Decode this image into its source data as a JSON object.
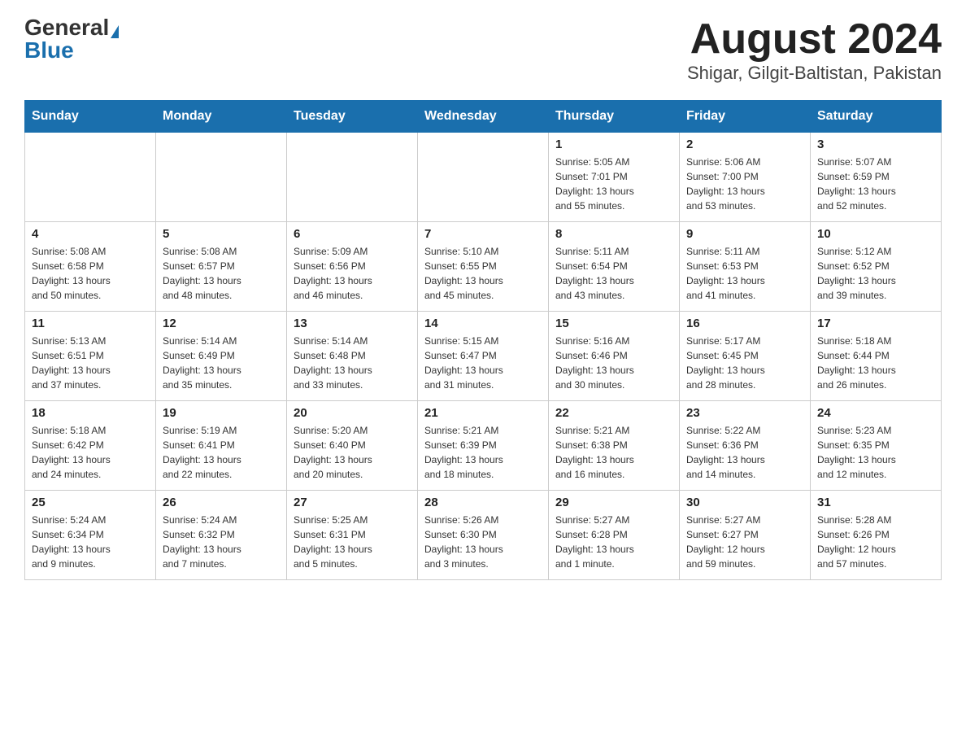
{
  "header": {
    "logo_general": "General",
    "logo_blue": "Blue",
    "month_title": "August 2024",
    "location": "Shigar, Gilgit-Baltistan, Pakistan"
  },
  "weekdays": [
    "Sunday",
    "Monday",
    "Tuesday",
    "Wednesday",
    "Thursday",
    "Friday",
    "Saturday"
  ],
  "weeks": [
    [
      {
        "day": "",
        "info": ""
      },
      {
        "day": "",
        "info": ""
      },
      {
        "day": "",
        "info": ""
      },
      {
        "day": "",
        "info": ""
      },
      {
        "day": "1",
        "info": "Sunrise: 5:05 AM\nSunset: 7:01 PM\nDaylight: 13 hours\nand 55 minutes."
      },
      {
        "day": "2",
        "info": "Sunrise: 5:06 AM\nSunset: 7:00 PM\nDaylight: 13 hours\nand 53 minutes."
      },
      {
        "day": "3",
        "info": "Sunrise: 5:07 AM\nSunset: 6:59 PM\nDaylight: 13 hours\nand 52 minutes."
      }
    ],
    [
      {
        "day": "4",
        "info": "Sunrise: 5:08 AM\nSunset: 6:58 PM\nDaylight: 13 hours\nand 50 minutes."
      },
      {
        "day": "5",
        "info": "Sunrise: 5:08 AM\nSunset: 6:57 PM\nDaylight: 13 hours\nand 48 minutes."
      },
      {
        "day": "6",
        "info": "Sunrise: 5:09 AM\nSunset: 6:56 PM\nDaylight: 13 hours\nand 46 minutes."
      },
      {
        "day": "7",
        "info": "Sunrise: 5:10 AM\nSunset: 6:55 PM\nDaylight: 13 hours\nand 45 minutes."
      },
      {
        "day": "8",
        "info": "Sunrise: 5:11 AM\nSunset: 6:54 PM\nDaylight: 13 hours\nand 43 minutes."
      },
      {
        "day": "9",
        "info": "Sunrise: 5:11 AM\nSunset: 6:53 PM\nDaylight: 13 hours\nand 41 minutes."
      },
      {
        "day": "10",
        "info": "Sunrise: 5:12 AM\nSunset: 6:52 PM\nDaylight: 13 hours\nand 39 minutes."
      }
    ],
    [
      {
        "day": "11",
        "info": "Sunrise: 5:13 AM\nSunset: 6:51 PM\nDaylight: 13 hours\nand 37 minutes."
      },
      {
        "day": "12",
        "info": "Sunrise: 5:14 AM\nSunset: 6:49 PM\nDaylight: 13 hours\nand 35 minutes."
      },
      {
        "day": "13",
        "info": "Sunrise: 5:14 AM\nSunset: 6:48 PM\nDaylight: 13 hours\nand 33 minutes."
      },
      {
        "day": "14",
        "info": "Sunrise: 5:15 AM\nSunset: 6:47 PM\nDaylight: 13 hours\nand 31 minutes."
      },
      {
        "day": "15",
        "info": "Sunrise: 5:16 AM\nSunset: 6:46 PM\nDaylight: 13 hours\nand 30 minutes."
      },
      {
        "day": "16",
        "info": "Sunrise: 5:17 AM\nSunset: 6:45 PM\nDaylight: 13 hours\nand 28 minutes."
      },
      {
        "day": "17",
        "info": "Sunrise: 5:18 AM\nSunset: 6:44 PM\nDaylight: 13 hours\nand 26 minutes."
      }
    ],
    [
      {
        "day": "18",
        "info": "Sunrise: 5:18 AM\nSunset: 6:42 PM\nDaylight: 13 hours\nand 24 minutes."
      },
      {
        "day": "19",
        "info": "Sunrise: 5:19 AM\nSunset: 6:41 PM\nDaylight: 13 hours\nand 22 minutes."
      },
      {
        "day": "20",
        "info": "Sunrise: 5:20 AM\nSunset: 6:40 PM\nDaylight: 13 hours\nand 20 minutes."
      },
      {
        "day": "21",
        "info": "Sunrise: 5:21 AM\nSunset: 6:39 PM\nDaylight: 13 hours\nand 18 minutes."
      },
      {
        "day": "22",
        "info": "Sunrise: 5:21 AM\nSunset: 6:38 PM\nDaylight: 13 hours\nand 16 minutes."
      },
      {
        "day": "23",
        "info": "Sunrise: 5:22 AM\nSunset: 6:36 PM\nDaylight: 13 hours\nand 14 minutes."
      },
      {
        "day": "24",
        "info": "Sunrise: 5:23 AM\nSunset: 6:35 PM\nDaylight: 13 hours\nand 12 minutes."
      }
    ],
    [
      {
        "day": "25",
        "info": "Sunrise: 5:24 AM\nSunset: 6:34 PM\nDaylight: 13 hours\nand 9 minutes."
      },
      {
        "day": "26",
        "info": "Sunrise: 5:24 AM\nSunset: 6:32 PM\nDaylight: 13 hours\nand 7 minutes."
      },
      {
        "day": "27",
        "info": "Sunrise: 5:25 AM\nSunset: 6:31 PM\nDaylight: 13 hours\nand 5 minutes."
      },
      {
        "day": "28",
        "info": "Sunrise: 5:26 AM\nSunset: 6:30 PM\nDaylight: 13 hours\nand 3 minutes."
      },
      {
        "day": "29",
        "info": "Sunrise: 5:27 AM\nSunset: 6:28 PM\nDaylight: 13 hours\nand 1 minute."
      },
      {
        "day": "30",
        "info": "Sunrise: 5:27 AM\nSunset: 6:27 PM\nDaylight: 12 hours\nand 59 minutes."
      },
      {
        "day": "31",
        "info": "Sunrise: 5:28 AM\nSunset: 6:26 PM\nDaylight: 12 hours\nand 57 minutes."
      }
    ]
  ]
}
